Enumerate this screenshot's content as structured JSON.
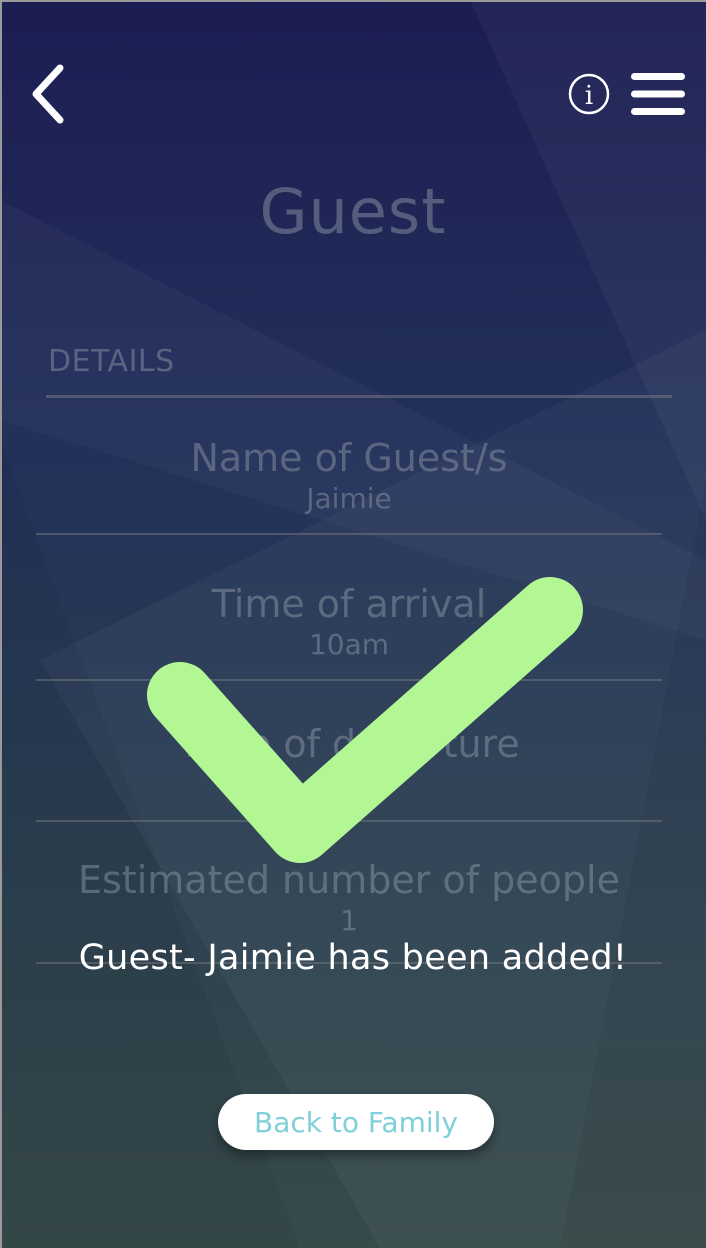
{
  "header": {
    "back_icon": "chevron-left-icon",
    "info_icon": "info-icon",
    "menu_icon": "hamburger-menu-icon"
  },
  "page": {
    "title": "Guest",
    "section_label": "DETAILS"
  },
  "fields": [
    {
      "label": "Name of Guest/s",
      "value": "Jaimie"
    },
    {
      "label": "Time of arrival",
      "value": "10am"
    },
    {
      "label": "Time of departure",
      "value": ""
    },
    {
      "label": "Estimated number of people",
      "value": "1"
    }
  ],
  "overlay": {
    "icon": "checkmark-icon",
    "check_color": "#b3f795",
    "message": "Guest- Jaimie has been added!",
    "back_button_label": "Back to Family",
    "back_button_text_color": "#7fd0d8"
  },
  "colors": {
    "background_top": "#1c1d52",
    "background_bottom": "#374b4b"
  }
}
